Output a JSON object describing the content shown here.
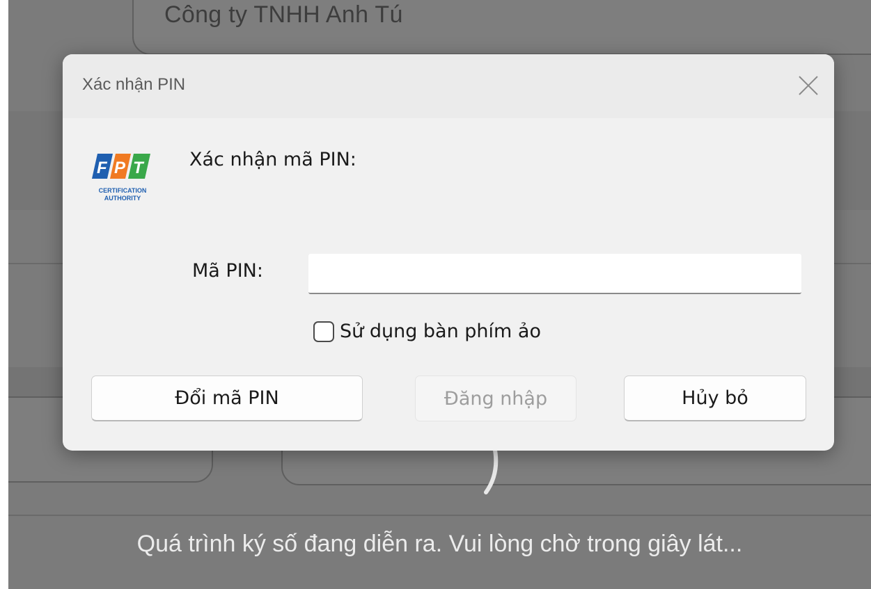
{
  "background": {
    "company_name": "Công ty TNHH Anh Tú",
    "progress_message": "Quá trình ký số đang diễn ra. Vui lòng chờ trong giây lát..."
  },
  "dialog": {
    "title": "Xác nhận PIN",
    "prompt": "Xác nhận mã PIN:",
    "pin_label": "Mã PIN:",
    "pin_value": "",
    "virtual_keyboard_label": "Sử dụng bàn phím ảo",
    "virtual_keyboard_checked": false,
    "buttons": {
      "change_pin": "Đổi mã PIN",
      "login": "Đăng nhập",
      "cancel": "Hủy bỏ"
    }
  },
  "logo": {
    "icon": "fpt-ca-logo",
    "line1": "CERTIFICATION",
    "line2": "AUTHORITY",
    "colors": {
      "blue": "#1f5fb0",
      "orange": "#f07a22",
      "green": "#3aa84a"
    }
  }
}
